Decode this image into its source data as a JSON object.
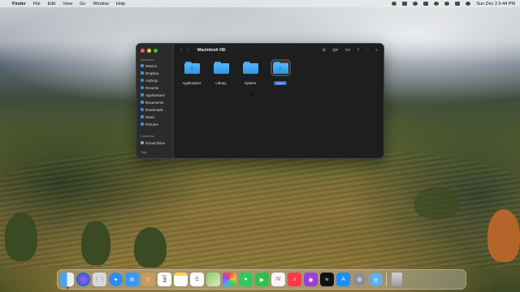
{
  "menubar": {
    "apple": "",
    "app": "Finder",
    "menus": [
      "File",
      "Edit",
      "View",
      "Go",
      "Window",
      "Help"
    ],
    "clock": "Sun Dec 3  5:44 PM"
  },
  "window": {
    "title": "Macintosh HD",
    "back": "‹",
    "forward": "›",
    "toolbar_icons": [
      "icon-view-icon",
      "group-icon",
      "share-icon",
      "tag-icon",
      "search-icon"
    ]
  },
  "sidebar": {
    "favorites_header": "Favorites",
    "items": [
      {
        "label": "Movies",
        "icon": "film-icon"
      },
      {
        "label": "Dropbox",
        "icon": "dropbox-icon"
      },
      {
        "label": "AirDrop",
        "icon": "airdrop-icon"
      },
      {
        "label": "Recents",
        "icon": "clock-icon"
      },
      {
        "label": "Applications",
        "icon": "applications-icon"
      },
      {
        "label": "Documents",
        "icon": "document-icon"
      },
      {
        "label": "Downloads",
        "icon": "download-icon"
      },
      {
        "label": "Music",
        "icon": "music-icon"
      },
      {
        "label": "Pictures",
        "icon": "photo-icon"
      }
    ],
    "locations_header": "Locations",
    "locations": [
      {
        "label": "iCloud Drive",
        "icon": "cloud-icon"
      }
    ],
    "tags_header": "Tags"
  },
  "files": [
    {
      "label": "Applications",
      "glyph": "A",
      "selected": false
    },
    {
      "label": "Library",
      "glyph": "",
      "selected": false
    },
    {
      "label": "System",
      "glyph": "",
      "selected": false
    },
    {
      "label": "Users",
      "glyph": "◎",
      "selected": true
    }
  ],
  "dock": {
    "calendar_month": "DEC",
    "calendar_day": "3",
    "apps": [
      "Finder",
      "Siri",
      "Launchpad",
      "Safari",
      "Mail",
      "Contacts",
      "Calendar",
      "Notes",
      "Reminders",
      "Maps",
      "Photos",
      "Messages",
      "FaceTime",
      "News",
      "Music",
      "Podcasts",
      "TV",
      "App Store",
      "System Settings",
      "Preview",
      "Trash"
    ]
  },
  "colors": {
    "folder": "#3ea6f0",
    "selection": "#2a62d4",
    "window_bg": "#1e1e1e",
    "sidebar_bg": "#2b2b2b"
  }
}
